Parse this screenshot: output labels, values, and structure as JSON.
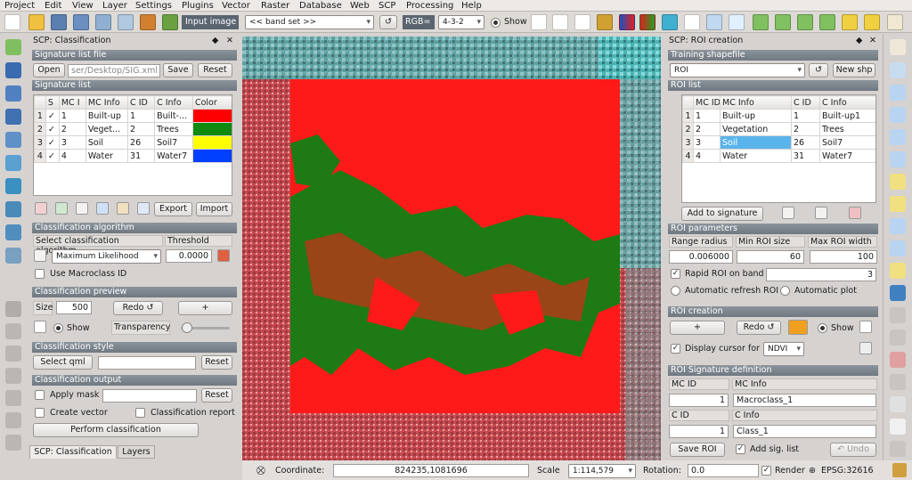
{
  "menu": [
    "Project",
    "Edit",
    "View",
    "Layer",
    "Settings",
    "Plugins",
    "Vector",
    "Raster",
    "Database",
    "Web",
    "SCP",
    "Processing",
    "Help"
  ],
  "toolbar": {
    "input_image_label": "Input image",
    "band_set": "<< band set >>",
    "rgb_label": "RGB=",
    "rgb_value": "4-3-2",
    "show_label": "Show"
  },
  "left": {
    "dock_title": "SCP: Classification",
    "sig_file_section": "Signature list file",
    "open_btn": "Open",
    "file_path": "ser/Desktop/SIG.xml",
    "save_btn": "Save",
    "reset_btn": "Reset",
    "sig_list_section": "Signature list",
    "columns": [
      "S",
      "MC I",
      "MC Info",
      "C ID",
      "C Info",
      "Color"
    ],
    "rows": [
      {
        "n": "1",
        "s": "✓",
        "mc_id": "1",
        "mc_info": "Built-up",
        "c_id": "1",
        "c_info": "Built-...",
        "color": "#ff0000"
      },
      {
        "n": "2",
        "s": "✓",
        "mc_id": "2",
        "mc_info": "Veget...",
        "c_id": "2",
        "c_info": "Trees",
        "color": "#0f8a0f"
      },
      {
        "n": "3",
        "s": "✓",
        "mc_id": "3",
        "mc_info": "Soil",
        "c_id": "26",
        "c_info": "Soil7",
        "color": "#ffff00"
      },
      {
        "n": "4",
        "s": "✓",
        "mc_id": "4",
        "mc_info": "Water",
        "c_id": "31",
        "c_info": "Water7",
        "color": "#0040ff"
      }
    ],
    "export_btn": "Export",
    "import_btn": "Import",
    "algo_section": "Classification algorithm",
    "select_algo_label": "Select classification algorithm",
    "threshold_label": "Threshold",
    "algo_value": "Maximum Likelihood",
    "threshold_value": "0.0000",
    "use_macroclass": "Use Macroclass ID",
    "preview_section": "Classification preview",
    "size_label": "Size",
    "size_value": "500",
    "redo_btn": "Redo ↺",
    "plus_btn": "+",
    "show_label": "Show",
    "transparency_label": "Transparency",
    "style_section": "Classification style",
    "select_qml_btn": "Select qml",
    "style_reset_btn": "Reset",
    "output_section": "Classification output",
    "apply_mask": "Apply mask",
    "mask_reset_btn": "Reset",
    "create_vector": "Create vector",
    "class_report": "Classification report",
    "perform_btn": "Perform classification",
    "tab_scp": "SCP: Classification",
    "tab_layers": "Layers"
  },
  "right": {
    "dock_title": "SCP: ROI creation",
    "training_section": "Training shapefile",
    "roi_combo": "ROI",
    "new_shp_btn": "New shp",
    "roi_list_section": "ROI list",
    "columns": [
      "MC ID",
      "MC Info",
      "C ID",
      "C Info"
    ],
    "rows": [
      {
        "n": "1",
        "mc_id": "1",
        "mc_info": "Built-up",
        "c_id": "1",
        "c_info": "Built-up1"
      },
      {
        "n": "2",
        "mc_id": "2",
        "mc_info": "Vegetation",
        "c_id": "2",
        "c_info": "Trees"
      },
      {
        "n": "3",
        "mc_id": "3",
        "mc_info": "Soil",
        "c_id": "26",
        "c_info": "Soil7"
      },
      {
        "n": "4",
        "mc_id": "4",
        "mc_info": "Water",
        "c_id": "31",
        "c_info": "Water7"
      }
    ],
    "add_sig_btn": "Add to signature",
    "params_section": "ROI parameters",
    "range_radius_label": "Range radius",
    "min_roi_label": "Min ROI size",
    "max_roi_label": "Max ROI width",
    "range_radius_value": "0.006000",
    "min_roi_value": "60",
    "max_roi_value": "100",
    "rapid_roi_label": "Rapid ROI on band",
    "rapid_roi_value": "3",
    "auto_refresh": "Automatic refresh ROI",
    "auto_plot": "Automatic  plot",
    "creation_section": "ROI creation",
    "plus_btn": "+",
    "redo_btn": "Redo ↺",
    "show_label": "Show",
    "display_cursor_label": "Display cursor for",
    "cursor_value": "NDVI",
    "sig_def_section": "ROI Signature definition",
    "mc_id_label": "MC ID",
    "mc_info_label": "MC Info",
    "mc_id_value": "1",
    "mc_info_value": "Macroclass_1",
    "c_id_label": "C ID",
    "c_info_label": "C Info",
    "c_id_value": "1",
    "c_info_value": "Class_1",
    "save_roi_btn": "Save ROI",
    "add_sig_list": "Add sig. list",
    "undo_btn": "↶ Undo"
  },
  "status": {
    "coordinate_label": "Coordinate:",
    "coordinate_value": "824235,1081696",
    "scale_label": "Scale",
    "scale_value": "1:114,579",
    "rotation_label": "Rotation:",
    "rotation_value": "0.0",
    "render_label": "Render",
    "crs": "EPSG:32616"
  },
  "colors": {
    "built_up": "#ff0000",
    "vegetation": "#0f8a0f",
    "soil": "#ffff00",
    "water": "#0040ff",
    "section_header": "#7a838b"
  }
}
